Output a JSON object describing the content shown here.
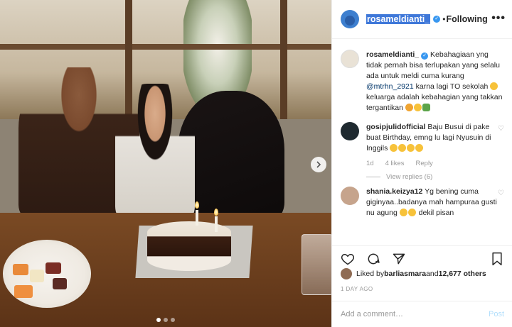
{
  "photo": {
    "next_icon": "chevron-right-icon",
    "dots_count": 3,
    "active_dot": 1
  },
  "header": {
    "username": "rosameldianti_",
    "separator": "•",
    "follow_status": "Following",
    "more_icon": "more-horizontal-icon"
  },
  "caption": {
    "username": "rosameldianti_",
    "text_part1": " Kebahagiaan yng tidak pernah bisa terlupakan yang selalu ada untuk meldi cuma kurang ",
    "mention": "@mtrhn_2921",
    "text_part2": " karna lagi TO sekolah ",
    "text_part3": " keluarga adalah kebahagian yang takkan tergantikan "
  },
  "comments": [
    {
      "username": "gosipjulidofficial",
      "text": " Baju Busui di pake buat Birthday, emng lu lagi Nyusuin di Inggils",
      "time": "1d",
      "likes": "4 likes",
      "reply": "Reply",
      "view_replies": "View replies (6)"
    },
    {
      "username": "shania.keizya12",
      "text": " Yg bening cuma giginyaa..badanya mah hampuraa gusti nu agung",
      "text_end": " dekil pisan"
    }
  ],
  "actions": {
    "like_icon": "heart-icon",
    "comment_icon": "comment-icon",
    "share_icon": "share-icon",
    "save_icon": "bookmark-icon"
  },
  "likes": {
    "prefix": "Liked by ",
    "user": "barliasmara",
    "middle": " and ",
    "count": "12,677 others"
  },
  "date": "1 DAY AGO",
  "add_comment": {
    "placeholder": "Add a comment…",
    "post_label": "Post"
  },
  "colors": {
    "link": "#003569",
    "verified": "#3897f0",
    "post_disabled": "#b2dffc",
    "username_highlight": "#3f78d9"
  }
}
